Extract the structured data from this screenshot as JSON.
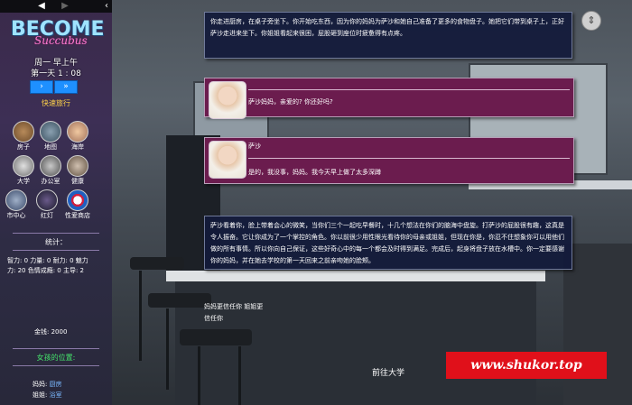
{
  "topbar": {
    "back_icon": "arrow-left-icon",
    "forward_icon": "arrow-right-icon",
    "collapse_icon": "chevron-left-icon"
  },
  "logo": {
    "big": "BECOME",
    "script": "Succubus"
  },
  "date": {
    "line1": "周一 早上午",
    "line2": "第一天 1 : 08"
  },
  "skip": {
    "next_label": "›",
    "skip_label": "»"
  },
  "quick_travel": "快速旅行",
  "locations": [
    {
      "label": "房子"
    },
    {
      "label": "地图"
    },
    {
      "label": "海岸"
    },
    {
      "label": "大学"
    },
    {
      "label": "办公室"
    },
    {
      "label": "健康"
    },
    {
      "label": "市中心"
    },
    {
      "label": "红灯"
    },
    {
      "label": "性爱商店"
    }
  ],
  "stats": {
    "title": "统计：",
    "line1": "智力: 0 力量: 0 耐力: 0 魅力",
    "line2": "力: 20 色情成瘾: 0 主导: 2"
  },
  "money": "金钱:     2000",
  "girls": {
    "title": "女孩的位置:",
    "rows": [
      {
        "name": "妈妈:",
        "place": "厨房"
      },
      {
        "name": "姐姐:",
        "place": "浴室"
      }
    ]
  },
  "narration_top": "你走进厨房，在桌子旁坐下。你开始吃东西，因为你的妈妈为萨沙和她自己准备了更多的食物盘子。她把它们带到桌子上，正好萨沙走进来坐下。你姐姐看起来很困，屁股砸到座位时疲惫得有点疼。",
  "chat1": {
    "name": "萨沙妈妈，亲爱的? 你还好吗?",
    "text": ""
  },
  "chat2": {
    "name": "萨沙",
    "text": "是的，我没事，妈妈。我今天早上做了太多深蹲"
  },
  "narration_bottom": "萨沙看着你，脸上带着会心的微笑，当你们三个一起吃早餐时，十几个想法在你们的脑海中盘旋。打萨沙的屁股很有趣，这真是令人振奋。它让你成为了一个掌控的角色。你以前很少用性眼光看待你的母亲或姐姐，但现在你是，你忍不住想象你可以用他们做的所有事情。所以你向自己保证，这些好奇心中的每一个都会及时得到满足。完成后，起身将盘子放在水槽中。你一定要感谢你的妈妈，并在她去学校的第一天回来之前亲吻她的脸颊。",
  "choice": {
    "label": "妈妈更信任你 姐姐更",
    "button": "信任你"
  },
  "action": "前往大学",
  "watermark": "www.shukor.top",
  "scroll_icon": "up-down-arrow-icon",
  "colors": {
    "narration_bg": "#121a3a",
    "chat_bg": "#6b1c4e",
    "accent_blue": "#1e90ff",
    "girls_title": "#45e36b"
  }
}
